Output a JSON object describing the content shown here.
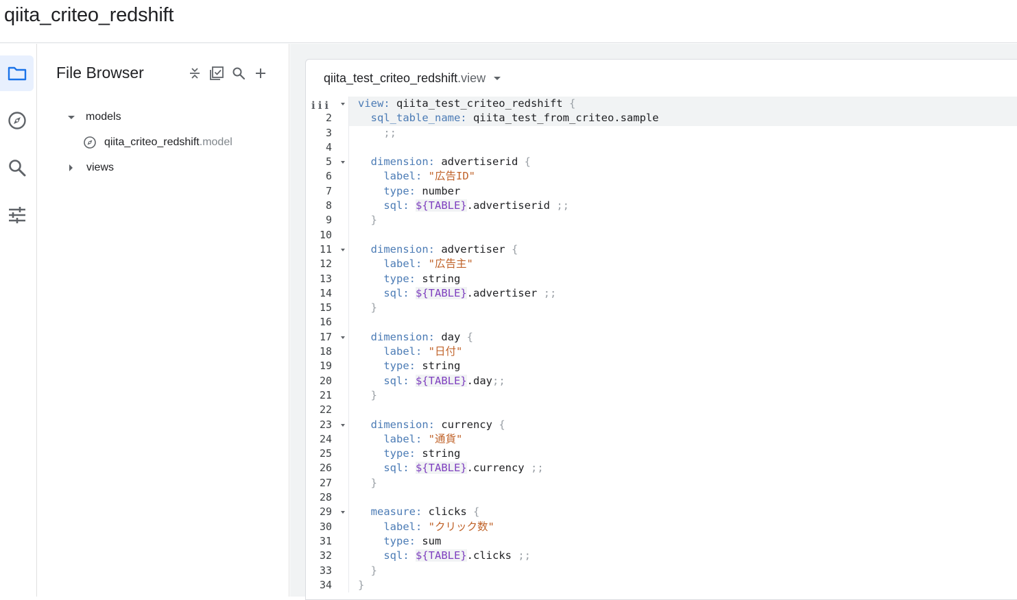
{
  "header": {
    "project_title": "qiita_criteo_redshift"
  },
  "rail": {
    "items": [
      {
        "name": "folder-icon",
        "active": true
      },
      {
        "name": "compass-icon",
        "active": false
      },
      {
        "name": "search-icon",
        "active": false
      },
      {
        "name": "sliders-icon",
        "active": false
      }
    ]
  },
  "file_browser": {
    "title": "File Browser",
    "tree": {
      "models_label": "models",
      "model_file_base": "qiita_criteo_redshift",
      "model_file_ext": ".model",
      "views_label": "views"
    }
  },
  "editor": {
    "tab_base": "qiita_test_criteo_redshift",
    "tab_ext": ".view",
    "lines": [
      {
        "n": "1",
        "fold": true
      },
      {
        "n": "2"
      },
      {
        "n": "3"
      },
      {
        "n": "4"
      },
      {
        "n": "5",
        "fold": true
      },
      {
        "n": "6"
      },
      {
        "n": "7"
      },
      {
        "n": "8"
      },
      {
        "n": "9"
      },
      {
        "n": "10"
      },
      {
        "n": "11",
        "fold": true
      },
      {
        "n": "12"
      },
      {
        "n": "13"
      },
      {
        "n": "14"
      },
      {
        "n": "15"
      },
      {
        "n": "16"
      },
      {
        "n": "17",
        "fold": true
      },
      {
        "n": "18"
      },
      {
        "n": "19"
      },
      {
        "n": "20"
      },
      {
        "n": "21"
      },
      {
        "n": "22"
      },
      {
        "n": "23",
        "fold": true
      },
      {
        "n": "24"
      },
      {
        "n": "25"
      },
      {
        "n": "26"
      },
      {
        "n": "27"
      },
      {
        "n": "28"
      },
      {
        "n": "29",
        "fold": true
      },
      {
        "n": "30"
      },
      {
        "n": "31"
      },
      {
        "n": "32"
      },
      {
        "n": "33"
      },
      {
        "n": "34"
      }
    ],
    "code": {
      "l1_k": "view:",
      "l1_v": " qiita_test_criteo_redshift ",
      "l1_p": "{",
      "l2_k": "  sql_table_name:",
      "l2_v": " qiita_test_from_criteo.sample",
      "l3_p": "    ;;",
      "l5_k": "  dimension:",
      "l5_v": " advertiserid ",
      "l5_p": "{",
      "l6_k": "    label:",
      "l6_s": " \"広告ID\"",
      "l7_k": "    type:",
      "l7_v": " number",
      "l8_k": "    sql:",
      "l8_t": "${TABLE}",
      "l8_v": ".advertiserid ",
      "l8_p": ";;",
      "l9_p": "  }",
      "l11_k": "  dimension:",
      "l11_v": " advertiser ",
      "l11_p": "{",
      "l12_k": "    label:",
      "l12_s": " \"広告主\"",
      "l13_k": "    type:",
      "l13_v": " string",
      "l14_k": "    sql:",
      "l14_t": "${TABLE}",
      "l14_v": ".advertiser ",
      "l14_p": ";;",
      "l15_p": "  }",
      "l17_k": "  dimension:",
      "l17_v": " day ",
      "l17_p": "{",
      "l18_k": "    label:",
      "l18_s": " \"日付\"",
      "l19_k": "    type:",
      "l19_v": " string",
      "l20_k": "    sql:",
      "l20_t": "${TABLE}",
      "l20_v": ".day",
      "l20_p": ";;",
      "l21_p": "  }",
      "l23_k": "  dimension:",
      "l23_v": " currency ",
      "l23_p": "{",
      "l24_k": "    label:",
      "l24_s": " \"通貨\"",
      "l25_k": "    type:",
      "l25_v": " string",
      "l26_k": "    sql:",
      "l26_t": "${TABLE}",
      "l26_v": ".currency ",
      "l26_p": ";;",
      "l27_p": "  }",
      "l29_k": "  measure:",
      "l29_v": " clicks ",
      "l29_p": "{",
      "l30_k": "    label:",
      "l30_s": " \"クリック数\"",
      "l31_k": "    type:",
      "l31_v": " sum",
      "l32_k": "    sql:",
      "l32_t": "${TABLE}",
      "l32_v": ".clicks ",
      "l32_p": ";;",
      "l33_p": "  }",
      "l34_p": "}"
    }
  }
}
